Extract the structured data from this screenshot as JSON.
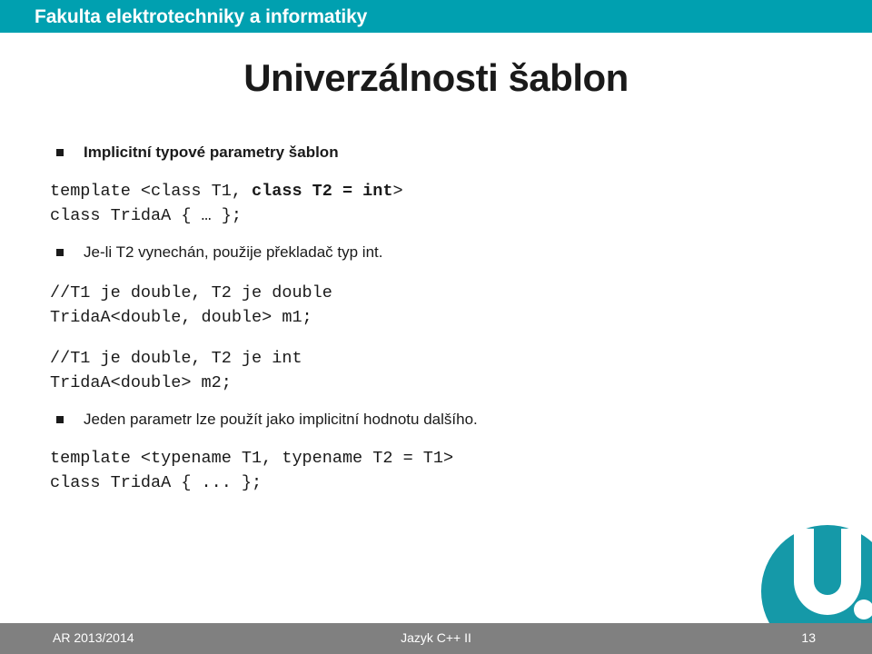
{
  "header": {
    "faculty_title": "Fakulta elektrotechniky a informatiky",
    "band_color": "#00a0b0"
  },
  "slide": {
    "title": "Univerzálnosti šablon"
  },
  "content": {
    "blocks": [
      {
        "kind": "bullet",
        "bold": true,
        "text": "Implicitní typové parametry šablon"
      },
      {
        "kind": "code",
        "line1_pre": "template <class T1, ",
        "line1_bold": "class T2 = int",
        "line1_post": ">",
        "line2": "class TridaA { … };"
      },
      {
        "kind": "bullet",
        "bold": false,
        "text": "Je-li T2 vynechán, použije překladač typ int."
      },
      {
        "kind": "code",
        "line1": "//T1 je double, T2 je double",
        "line2": "TridaA<double, double> m1;"
      },
      {
        "kind": "code",
        "line1": "//T1 je double, T2 je int",
        "line2": "TridaA<double> m2;"
      },
      {
        "kind": "bullet",
        "bold": false,
        "text": "Jeden parametr lze použít jako implicitní hodnotu dalšího."
      },
      {
        "kind": "code",
        "line1": "template <typename T1, typename T2 = T1>",
        "line2": "class TridaA { ... };"
      }
    ]
  },
  "logo": {
    "name": "university-u-logo",
    "teal": "#1599a8",
    "dot_white": "#ffffff",
    "dot_gray": "#9a9a9a"
  },
  "footer": {
    "left": "AR 2013/2014",
    "center": "Jazyk C++ II",
    "page_number": "13",
    "band_color": "#808080"
  }
}
